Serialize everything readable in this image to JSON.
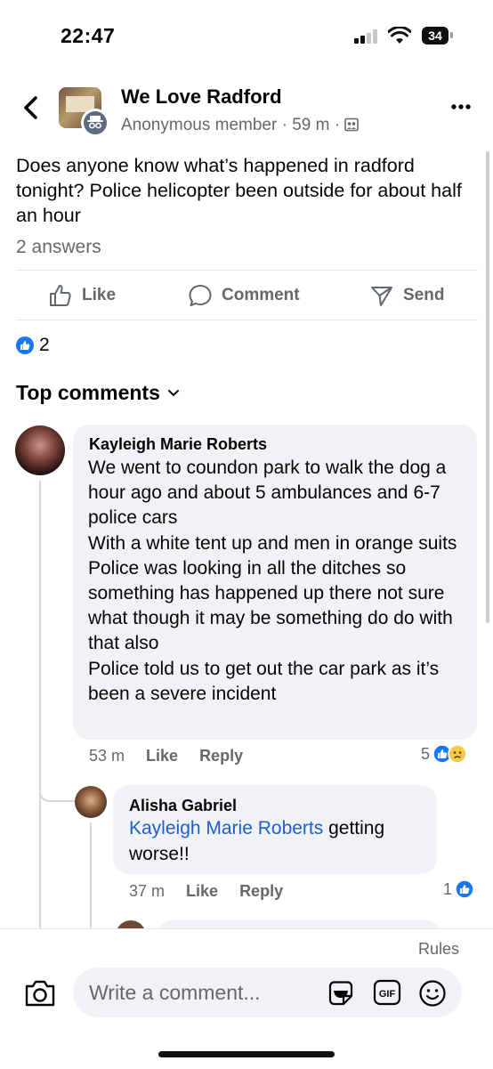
{
  "status_bar": {
    "time": "22:47",
    "battery": "34"
  },
  "header": {
    "group_name": "We Love Radford",
    "author": "Anonymous member",
    "time_ago": "59 m",
    "separator": "·",
    "audience_icon": "group-audience-icon"
  },
  "post": {
    "text": "Does anyone know what’s happened in radford tonight? Police helicopter been outside for about half an hour",
    "answers": "2 answers"
  },
  "actions": {
    "like": "Like",
    "comment": "Comment",
    "send": "Send"
  },
  "reactions": {
    "count": "2"
  },
  "comments_header": {
    "label": "Top comments"
  },
  "comments": [
    {
      "author": "Kayleigh Marie Roberts",
      "text": "We went to coundon park to walk the dog a hour ago and about 5 ambulances and 6-7 police cars\nWith a white tent up and men in orange suits\nPolice was looking in all the ditches so something has happened up there not sure what though it may be something do do with that also\nPolice told us to get out the car park as it’s been a severe incident",
      "time": "53 m",
      "like": "Like",
      "reply": "Reply",
      "reaction_count": "5"
    },
    {
      "author": "Alisha Gabriel",
      "mention": "Kayleigh Marie Roberts",
      "text": " getting worse!!",
      "time": "37 m",
      "like": "Like",
      "reply": "Reply",
      "reaction_count": "1"
    }
  ],
  "composer": {
    "rules": "Rules",
    "placeholder": "Write a comment...",
    "gif": "GIF"
  },
  "colors": {
    "accent": "#1877f2",
    "mention": "#1b5fd1",
    "secondary_text": "#65676b",
    "bubble": "#f0f2f5"
  }
}
